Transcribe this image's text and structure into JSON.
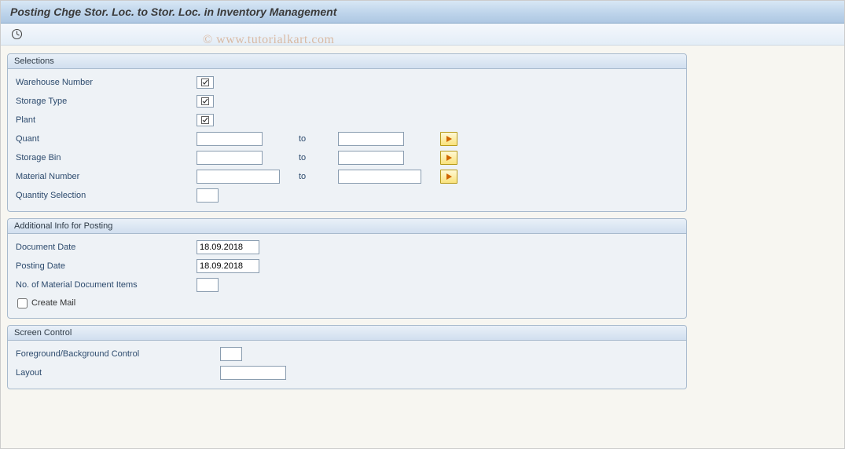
{
  "window": {
    "title": "Posting Chge Stor. Loc. to Stor. Loc. in Inventory Management"
  },
  "watermark": "© www.tutorialkart.com",
  "groups": {
    "selections": {
      "title": "Selections",
      "fields": {
        "warehouse_number": {
          "label": "Warehouse Number"
        },
        "storage_type": {
          "label": "Storage Type"
        },
        "plant": {
          "label": "Plant"
        },
        "quant": {
          "label": "Quant",
          "from": "",
          "to_label": "to",
          "to": ""
        },
        "storage_bin": {
          "label": "Storage Bin",
          "from": "",
          "to_label": "to",
          "to": ""
        },
        "material_number": {
          "label": "Material Number",
          "from": "",
          "to_label": "to",
          "to": ""
        },
        "quantity_selection": {
          "label": "Quantity Selection",
          "value": ""
        }
      }
    },
    "posting": {
      "title": "Additional Info for Posting",
      "fields": {
        "document_date": {
          "label": "Document Date",
          "value": "18.09.2018"
        },
        "posting_date": {
          "label": "Posting Date",
          "value": "18.09.2018"
        },
        "no_items": {
          "label": "No. of Material Document Items",
          "value": ""
        },
        "create_mail": {
          "label": "Create Mail",
          "checked": false
        }
      }
    },
    "screen": {
      "title": "Screen Control",
      "fields": {
        "fg_bg": {
          "label": "Foreground/Background Control",
          "value": ""
        },
        "layout": {
          "label": "Layout",
          "value": ""
        }
      }
    }
  }
}
